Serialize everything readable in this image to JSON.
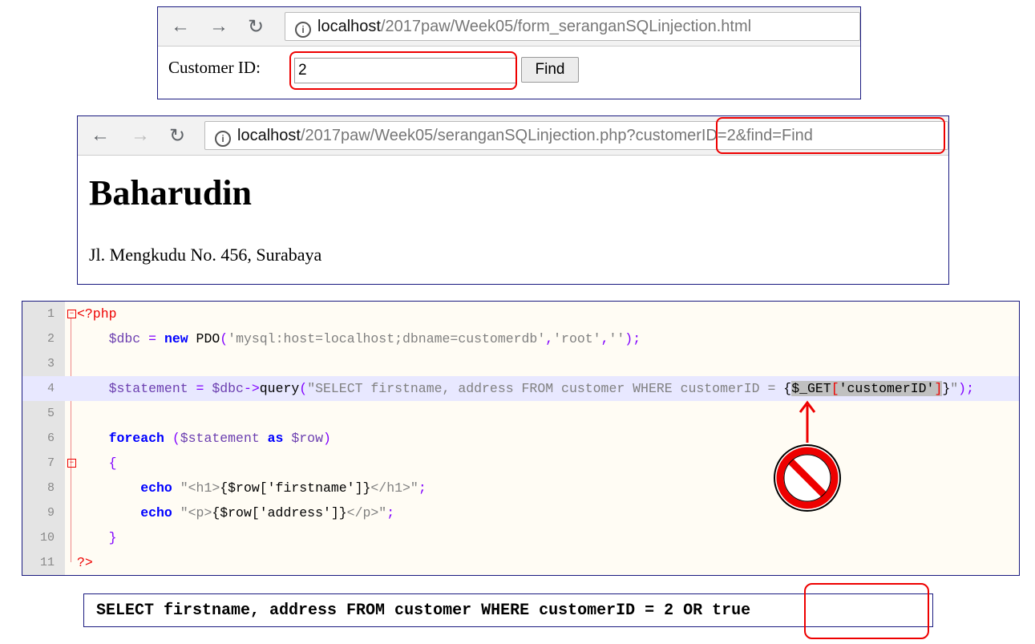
{
  "browser1": {
    "url_host": "localhost",
    "url_path": "/2017paw/Week05/form_seranganSQLinjection.html",
    "label": "Customer ID:",
    "input_value": "2",
    "button": "Find"
  },
  "browser2": {
    "url_host": "localhost",
    "url_path": "/2017paw/Week05/seranganSQLinjection.php?",
    "url_query": "customerID=2&find=Find",
    "heading": "Baharudin",
    "address": "Jl. Mengkudu No. 456, Surabaya"
  },
  "code": {
    "lines": [
      {
        "n": "1",
        "tokens": [
          [
            "<?php",
            "tag"
          ]
        ]
      },
      {
        "n": "2",
        "tokens": [
          [
            "    $dbc ",
            "var"
          ],
          [
            "= ",
            "op"
          ],
          [
            "new ",
            "kw"
          ],
          [
            "PDO",
            "plain"
          ],
          [
            "(",
            "op"
          ],
          [
            "'mysql:host=localhost;dbname=customerdb'",
            "str"
          ],
          [
            ",",
            "op"
          ],
          [
            "'root'",
            "str"
          ],
          [
            ",",
            "op"
          ],
          [
            "''",
            "str"
          ],
          [
            ");",
            "op"
          ]
        ]
      },
      {
        "n": "3",
        "tokens": []
      },
      {
        "n": "4",
        "tokens": [
          [
            "    $statement ",
            "var"
          ],
          [
            "= ",
            "op"
          ],
          [
            "$dbc",
            "var"
          ],
          [
            "->",
            "op"
          ],
          [
            "query",
            "plain"
          ],
          [
            "(",
            "op"
          ],
          [
            "\"SELECT firstname, address FROM customer WHERE customerID = ",
            "str"
          ],
          [
            "{",
            "plain"
          ],
          [
            "$_GET",
            "sel"
          ],
          [
            "[",
            "br"
          ],
          [
            "'customerID'",
            "sel"
          ],
          [
            "]",
            "br"
          ],
          [
            "}",
            "plain"
          ],
          [
            "\"",
            "str"
          ],
          [
            ");",
            "op"
          ]
        ]
      },
      {
        "n": "5",
        "tokens": []
      },
      {
        "n": "6",
        "tokens": [
          [
            "    foreach ",
            "kw"
          ],
          [
            "(",
            "op"
          ],
          [
            "$statement ",
            "var"
          ],
          [
            "as ",
            "kw"
          ],
          [
            "$row",
            "var"
          ],
          [
            ")",
            "op"
          ]
        ]
      },
      {
        "n": "7",
        "tokens": [
          [
            "    {",
            "op"
          ]
        ]
      },
      {
        "n": "8",
        "tokens": [
          [
            "        echo ",
            "kw"
          ],
          [
            "\"<h1>",
            "str"
          ],
          [
            "{$row['firstname']}",
            "plain"
          ],
          [
            "</h1>\"",
            "str"
          ],
          [
            ";",
            "op"
          ]
        ]
      },
      {
        "n": "9",
        "tokens": [
          [
            "        echo ",
            "kw"
          ],
          [
            "\"<p>",
            "str"
          ],
          [
            "{$row['address']}",
            "plain"
          ],
          [
            "</p>\"",
            "str"
          ],
          [
            ";",
            "op"
          ]
        ]
      },
      {
        "n": "10",
        "tokens": [
          [
            "    }",
            "op"
          ]
        ]
      },
      {
        "n": "11",
        "tokens": [
          [
            "?>",
            "tag"
          ]
        ]
      }
    ]
  },
  "sql": {
    "prefix": "SELECT firstname, address FROM customer WHERE customerID = ",
    "injected": "2 OR true"
  },
  "colors": {
    "annotation_red": "#e00000",
    "frame": "#1a1a80"
  }
}
